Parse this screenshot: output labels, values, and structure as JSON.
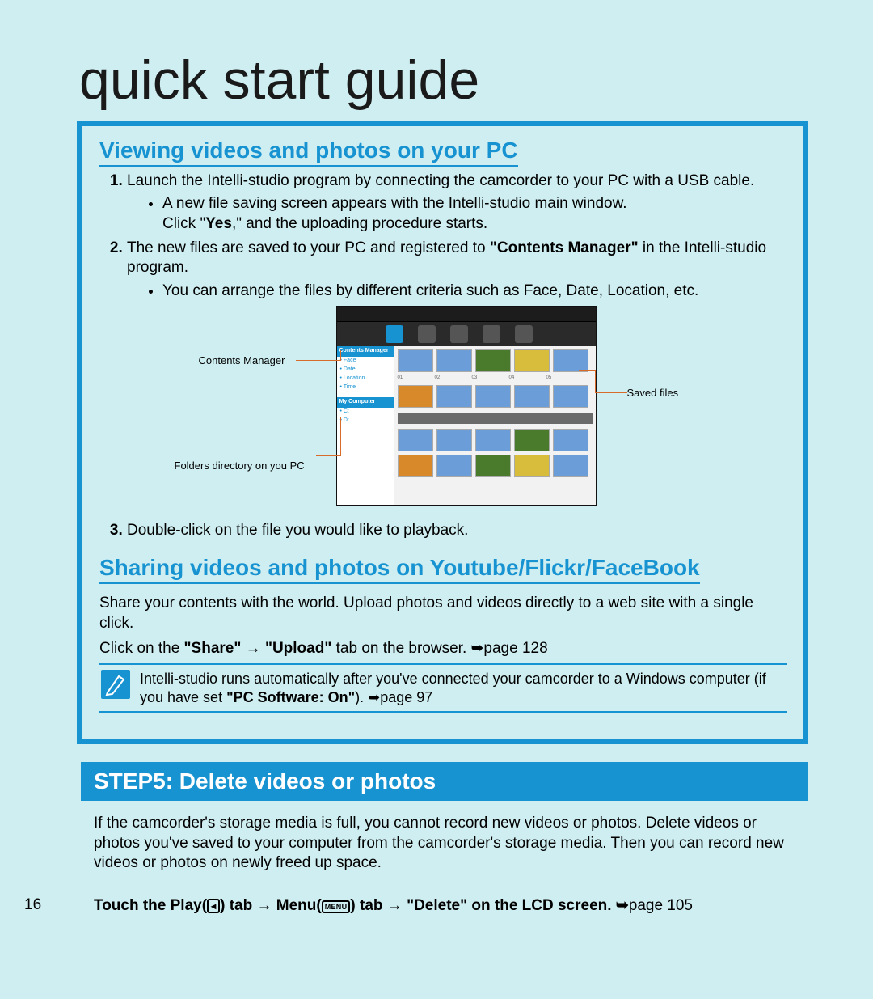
{
  "page_title": "quick start guide",
  "page_number": "16",
  "section1": {
    "heading": "Viewing videos and photos on your PC",
    "step1": "Launch the Intelli-studio program by connecting the camcorder to your PC with a USB cable.",
    "step1_sub_a": "A new file saving screen appears with the Intelli-studio main window.",
    "step1_sub_b_pre": "Click \"",
    "step1_sub_b_bold": "Yes",
    "step1_sub_b_post": ",\" and the uploading procedure starts.",
    "step2_pre": "The new files are saved to your PC and registered to ",
    "step2_bold": "\"Contents Manager\"",
    "step2_post": " in the Intelli-studio program.",
    "step2_sub": "You can arrange the files by different criteria such as Face, Date, Location, etc.",
    "step3": "Double-click on the file you would like to playback."
  },
  "figure": {
    "label_contents": "Contents Manager",
    "label_folders": "Folders directory on you PC",
    "label_saved": "Saved files"
  },
  "section2": {
    "heading": "Sharing videos and photos on Youtube/Flickr/FaceBook",
    "p1": "Share your contents with the world. Upload photos and videos directly to a web site with a single click.",
    "p2_pre": "Click on the ",
    "p2_b1": "\"Share\"",
    "p2_arrow": " → ",
    "p2_b2": "\"Upload\"",
    "p2_post": " tab on the browser. ➥page 128",
    "note_pre": "Intelli-studio runs automatically after you've connected your camcorder to a Windows computer (if you have set ",
    "note_bold": "\"PC Software: On\"",
    "note_post": "). ➥page 97"
  },
  "step5": {
    "bar": "STEP5: Delete videos or photos",
    "p": "If the camcorder's storage media is full, you cannot record new videos or photos. Delete videos or photos you've saved to your computer from the camcorder's storage media. Then you can record new videos or photos on newly freed up space.",
    "t_pre": "Touch the Play(",
    "t_mid1": ") tab → Menu(",
    "t_mid2": ") tab → \"Delete\" on the LCD screen. ➥",
    "t_post": "page 105"
  }
}
